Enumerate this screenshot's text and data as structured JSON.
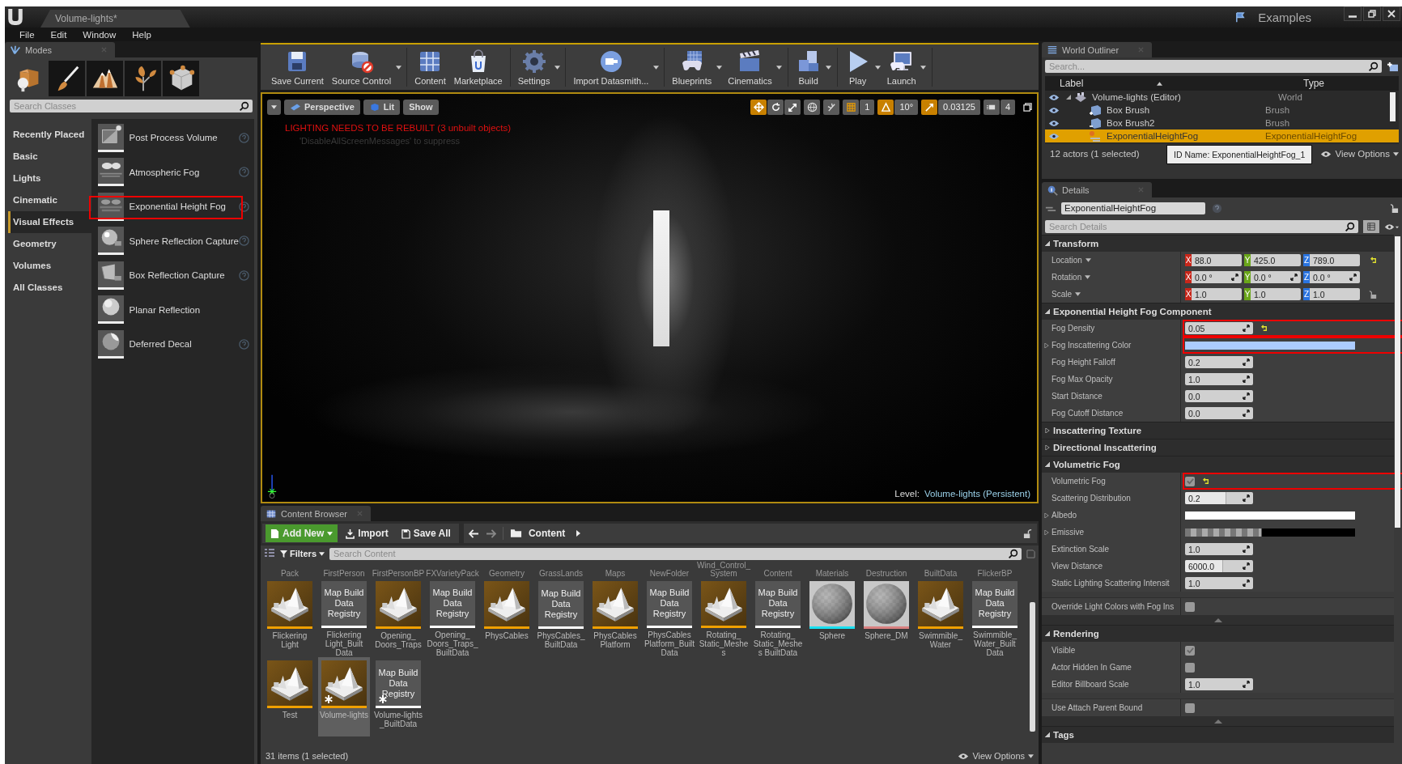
{
  "title_bar": {
    "tab": "Volume-lights*",
    "project": "Examples"
  },
  "menu": [
    "File",
    "Edit",
    "Window",
    "Help"
  ],
  "modes": {
    "tab": "Modes",
    "tools": [
      {
        "kind": "place",
        "selected": true
      },
      {
        "kind": "paint",
        "selected": false
      },
      {
        "kind": "landscape",
        "selected": false
      },
      {
        "kind": "foliage",
        "selected": false
      },
      {
        "kind": "geometry",
        "selected": false
      }
    ],
    "search": {
      "placeholder": "Search Classes"
    },
    "categories": [
      {
        "label": "Recently Placed",
        "selected": false
      },
      {
        "label": "Basic",
        "selected": false
      },
      {
        "label": "Lights",
        "selected": false
      },
      {
        "label": "Cinematic",
        "selected": false
      },
      {
        "label": "Visual Effects",
        "selected": true
      },
      {
        "label": "Geometry",
        "selected": false
      },
      {
        "label": "Volumes",
        "selected": false
      },
      {
        "label": "All Classes",
        "selected": false
      }
    ],
    "items": [
      {
        "label": "Post Process Volume",
        "kind": "volume",
        "help": true,
        "highlighted": false
      },
      {
        "label": "Atmospheric Fog",
        "kind": "cloud",
        "help": true,
        "highlighted": false
      },
      {
        "label": "Exponential Height Fog",
        "kind": "fog",
        "help": true,
        "highlighted": true
      },
      {
        "label": "Sphere Reflection Capture",
        "kind": "capture",
        "help": true,
        "highlighted": false
      },
      {
        "label": "Box Reflection Capture",
        "kind": "box",
        "help": true,
        "highlighted": false
      },
      {
        "label": "Planar Reflection",
        "kind": "sphere",
        "help": false,
        "highlighted": false
      },
      {
        "label": "Deferred Decal",
        "kind": "decal",
        "help": true,
        "highlighted": false
      }
    ]
  },
  "toolbar": [
    [
      {
        "label": "Save Current",
        "kind": "save",
        "dropdown": false
      },
      {
        "label": "Source Control",
        "kind": "source",
        "dropdown": true
      }
    ],
    [
      {
        "label": "Content",
        "kind": "content",
        "dropdown": false
      },
      {
        "label": "Marketplace",
        "kind": "market",
        "dropdown": false
      }
    ],
    [
      {
        "label": "Settings",
        "kind": "settings",
        "dropdown": true
      }
    ],
    [
      {
        "label": "Import Datasmith...",
        "kind": "datasmith",
        "dropdown": true
      }
    ],
    [
      {
        "label": "Blueprints",
        "kind": "blueprints",
        "dropdown": true
      },
      {
        "label": "Cinematics",
        "kind": "cinematics",
        "dropdown": true
      }
    ],
    [
      {
        "label": "Build",
        "kind": "build",
        "dropdown": true
      }
    ],
    [
      {
        "label": "Play",
        "kind": "play",
        "dropdown": true
      },
      {
        "label": "Launch",
        "kind": "launch",
        "dropdown": true
      }
    ]
  ],
  "viewport": {
    "view": "Perspective",
    "mode": "Lit",
    "show": "Show",
    "transform_tools": [
      {
        "kind": "move",
        "selected": true
      },
      {
        "kind": "rotate",
        "selected": false
      },
      {
        "kind": "scale",
        "selected": false
      }
    ],
    "snaps": [
      {
        "kind": "grid",
        "on": false,
        "value": "1"
      },
      {
        "kind": "angle",
        "on": true,
        "value": "10°"
      },
      {
        "kind": "resize",
        "on": true,
        "value": "0.03125"
      }
    ],
    "camera_speed": "4",
    "warning": "LIGHTING NEEDS TO BE REBUILT (3 unbuilt objects)",
    "hint": "'DisableAllScreenMessages' to suppress",
    "level_label": "Level:",
    "level_name": "Volume-lights (Persistent)"
  },
  "content_browser": {
    "tab": "Content Browser",
    "actions": [
      {
        "label": "Add New",
        "kind": "add"
      },
      {
        "label": "Import",
        "kind": "import"
      },
      {
        "label": "Save All",
        "kind": "save"
      }
    ],
    "path": "Content",
    "filters": "Filters",
    "search": {
      "placeholder": "Search Content"
    },
    "folder_labels": [
      "Pack",
      "FirstPerson",
      "FirstPersonBP",
      "FXVarietyPack",
      "Geometry",
      "GrassLands",
      "Maps",
      "NewFolder",
      "Wind_Control_ System",
      "Content",
      "Materials",
      "Destruction",
      "BuiltData",
      "FlickerBP"
    ],
    "assets": [
      {
        "label": "Flickering Light",
        "kind": "map",
        "color": "#f0a000",
        "selected": false,
        "unsaved": false
      },
      {
        "label": "Flickering Light_Built Data",
        "kind": "registry",
        "thumb_text": "Map Build Data Registry",
        "color": "#ffffff",
        "selected": false,
        "unsaved": false
      },
      {
        "label": "Opening_ Doors_Traps",
        "kind": "map",
        "color": "#f0a000",
        "selected": false,
        "unsaved": false
      },
      {
        "label": "Opening_ Doors_Traps_ BuiltData",
        "kind": "registry",
        "thumb_text": "Map Build Data Registry",
        "color": "#ffffff",
        "selected": false,
        "unsaved": false
      },
      {
        "label": "PhysCables",
        "kind": "map",
        "color": "#f0a000",
        "selected": false,
        "unsaved": false
      },
      {
        "label": "PhysCables_ BuiltData",
        "kind": "registry",
        "thumb_text": "Map Build Data Registry",
        "color": "#ffffff",
        "selected": false,
        "unsaved": false
      },
      {
        "label": "PhysCables Platform",
        "kind": "map",
        "color": "#f0a000",
        "selected": false,
        "unsaved": false
      },
      {
        "label": "PhysCables Platform_Built Data",
        "kind": "registry",
        "thumb_text": "Map Build Data Registry",
        "color": "#ffffff",
        "selected": false,
        "unsaved": false
      },
      {
        "label": "Rotating_ Static_Meshes",
        "kind": "map",
        "color": "#f0a000",
        "selected": false,
        "unsaved": false
      },
      {
        "label": "Rotating_ Static_Meshes BuiltData",
        "kind": "registry",
        "thumb_text": "Map Build Data Registry",
        "color": "#ffffff",
        "selected": false,
        "unsaved": false
      },
      {
        "label": "Sphere",
        "kind": "sphere",
        "color": "#19e0f0",
        "selected": false,
        "unsaved": false
      },
      {
        "label": "Sphere_DM",
        "kind": "sphere",
        "color": "#d98080",
        "selected": false,
        "unsaved": false
      },
      {
        "label": "Swimmible_ Water",
        "kind": "map",
        "color": "#f0a000",
        "selected": false,
        "unsaved": false
      },
      {
        "label": "Swimmible_ Water_Built Data",
        "kind": "registry",
        "thumb_text": "Map Build Data Registry",
        "color": "#ffffff",
        "selected": false,
        "unsaved": false
      },
      {
        "label": "Test",
        "kind": "map",
        "color": "#f0a000",
        "selected": false,
        "unsaved": false
      },
      {
        "label": "Volume-lights",
        "kind": "map",
        "color": "#f0a000",
        "selected": true,
        "unsaved": true
      },
      {
        "label": "Volume-lights _BuiltData",
        "kind": "registry",
        "thumb_text": "Map Build Data Registry",
        "color": "#ffffff",
        "selected": false,
        "unsaved": true
      }
    ],
    "footer": "31 items (1 selected)",
    "view_options": "View Options"
  },
  "outliner": {
    "tab": "World Outliner",
    "search": {
      "placeholder": "Search..."
    },
    "columns": [
      "Label",
      "Type"
    ],
    "rows": [
      {
        "label": "Volume-lights (Editor)",
        "type": "World",
        "kind": "world",
        "selected": false,
        "expanded": true,
        "children": [
          {
            "label": "Box Brush",
            "type": "Brush",
            "kind": "brush-add",
            "selected": false
          },
          {
            "label": "Box Brush2",
            "type": "Brush",
            "kind": "brush-sub",
            "selected": false
          },
          {
            "label": "ExponentialHeightFog",
            "type": "ExponentialHeightFog",
            "kind": "fog",
            "selected": true
          }
        ]
      }
    ],
    "footer": "12 actors (1 selected)",
    "tooltip": "ID Name: ExponentialHeightFog_1",
    "view_options": "View Options"
  },
  "details": {
    "tab": "Details",
    "actor_name": "ExponentialHeightFog",
    "search": {
      "placeholder": "Search Details"
    },
    "sections": [
      {
        "title": "Transform",
        "expanded": true,
        "rows": [
          {
            "kind": "vector",
            "label": "Location",
            "values": [
              {
                "axis": "X",
                "value": "88.0"
              },
              {
                "axis": "Y",
                "value": "425.0"
              },
              {
                "axis": "Z",
                "value": "789.0"
              }
            ],
            "spin": false,
            "lock": false,
            "modified": true
          },
          {
            "kind": "vector",
            "label": "Rotation",
            "values": [
              {
                "axis": "X",
                "value": "0.0 °"
              },
              {
                "axis": "Y",
                "value": "0.0 °"
              },
              {
                "axis": "Z",
                "value": "0.0 °"
              }
            ],
            "spin": true,
            "lock": false,
            "modified": false
          },
          {
            "kind": "vector",
            "label": "Scale",
            "values": [
              {
                "axis": "X",
                "value": "1.0"
              },
              {
                "axis": "Y",
                "value": "1.0"
              },
              {
                "axis": "Z",
                "value": "1.0"
              }
            ],
            "spin": false,
            "lock": true,
            "modified": false
          }
        ]
      },
      {
        "title": "Exponential Height Fog Component",
        "expanded": true,
        "rows": [
          {
            "kind": "number",
            "label": "Fog Density",
            "value": "0.05",
            "modified": true,
            "highlighted": true
          },
          {
            "kind": "color",
            "label": "Fog Inscattering Color",
            "color": "#acccff",
            "alpha": false,
            "modified": false,
            "highlighted": true
          },
          {
            "kind": "number",
            "label": "Fog Height Falloff",
            "value": "0.2",
            "modified": false,
            "highlighted": false
          },
          {
            "kind": "number",
            "label": "Fog Max Opacity",
            "value": "1.0",
            "modified": false,
            "highlighted": false
          },
          {
            "kind": "number",
            "label": "Start Distance",
            "value": "0.0",
            "modified": false,
            "highlighted": false
          },
          {
            "kind": "number",
            "label": "Fog Cutoff Distance",
            "value": "0.0",
            "modified": false,
            "highlighted": false
          }
        ]
      },
      {
        "title": "Inscattering Texture",
        "expanded": false
      },
      {
        "title": "Directional Inscattering",
        "expanded": false
      },
      {
        "title": "Volumetric Fog",
        "expanded": true,
        "rows": [
          {
            "kind": "checkbox",
            "label": "Volumetric Fog",
            "checked": true,
            "modified": true,
            "highlighted": true
          },
          {
            "kind": "number",
            "label": "Scattering Distribution",
            "value": "0.2",
            "level": 0.6,
            "modified": false,
            "highlighted": false
          },
          {
            "kind": "color",
            "label": "Albedo",
            "color": "#ffffff",
            "alpha": false,
            "modified": false,
            "highlighted": false
          },
          {
            "kind": "color",
            "label": "Emissive",
            "color": "#000000",
            "alpha": true,
            "modified": false,
            "highlighted": false
          },
          {
            "kind": "number",
            "label": "Extinction Scale",
            "value": "1.0",
            "modified": false,
            "highlighted": false
          },
          {
            "kind": "number",
            "label": "View Distance",
            "value": "6000.0",
            "level": 0.55,
            "modified": false,
            "highlighted": false
          },
          {
            "kind": "number",
            "label": "Static Lighting Scattering Intensit",
            "value": "1.0",
            "modified": false,
            "highlighted": false
          }
        ],
        "advanced_rows": [
          {
            "kind": "checkbox",
            "label": "Override Light Colors with Fog Ins",
            "checked": false,
            "modified": false,
            "highlighted": false
          }
        ]
      },
      {
        "title": "Rendering",
        "expanded": true,
        "rows": [
          {
            "kind": "checkbox",
            "label": "Visible",
            "checked": true,
            "modified": false,
            "highlighted": false
          },
          {
            "kind": "checkbox",
            "label": "Actor Hidden In Game",
            "checked": false,
            "modified": false,
            "highlighted": false
          },
          {
            "kind": "number",
            "label": "Editor Billboard Scale",
            "value": "1.0",
            "modified": false,
            "highlighted": false
          }
        ],
        "advanced_rows": [
          {
            "kind": "checkbox",
            "label": "Use Attach Parent Bound",
            "checked": false,
            "modified": false,
            "highlighted": false
          }
        ]
      },
      {
        "title": "Tags",
        "expanded": true
      }
    ]
  }
}
